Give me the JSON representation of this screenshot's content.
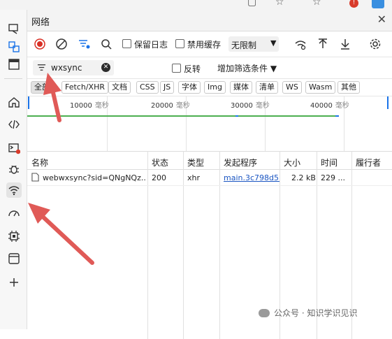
{
  "panel": {
    "title": "网络",
    "close_glyph": "✕"
  },
  "toolbar": {
    "preserve_log": "保留日志",
    "disable_cache": "禁用缓存",
    "throttling": "无限制",
    "throttling_arrow": "▼"
  },
  "filter": {
    "value": "wxsync",
    "clear_glyph": "✕",
    "invert": "反转",
    "more_filters": "增加筛选条件 ▼"
  },
  "type_filters": [
    "全部",
    "Fetch/XHR",
    "文档",
    "CSS",
    "JS",
    "字体",
    "Img",
    "媒体",
    "清单",
    "WS",
    "Wasm",
    "其他"
  ],
  "timeline": {
    "ticks": [
      "10000",
      "20000",
      "30000",
      "40000"
    ],
    "unit": "毫秒"
  },
  "table": {
    "columns": [
      "名称",
      "状态",
      "类型",
      "发起程序",
      "大小",
      "时间",
      "履行者"
    ],
    "rows": [
      {
        "name": "webwxsync?sid=QNgNQz...",
        "status": "200",
        "type": "xhr",
        "initiator": "main.3c798d5...",
        "size": "2.2 kB",
        "time": "229 ..."
      }
    ]
  },
  "watermark": "公众号 · 知识学识见识",
  "icons": {
    "sidebar": [
      "device-icon",
      "elements-icon",
      "window-icon",
      "home-icon",
      "code-icon",
      "console-icon",
      "bug-icon",
      "wifi-icon",
      "gauge-icon",
      "chip-icon",
      "panel-icon",
      "plus-icon"
    ],
    "toolbar": [
      "record-icon",
      "clear-icon",
      "filter-icon",
      "search-icon",
      "wifi-settings-icon",
      "upload-icon",
      "download-icon",
      "gear-icon"
    ]
  },
  "colors": {
    "record": "#d93025",
    "link": "#1a55c2",
    "waterfall_green": "#4caf50",
    "accent_blue": "#1a73e8"
  }
}
